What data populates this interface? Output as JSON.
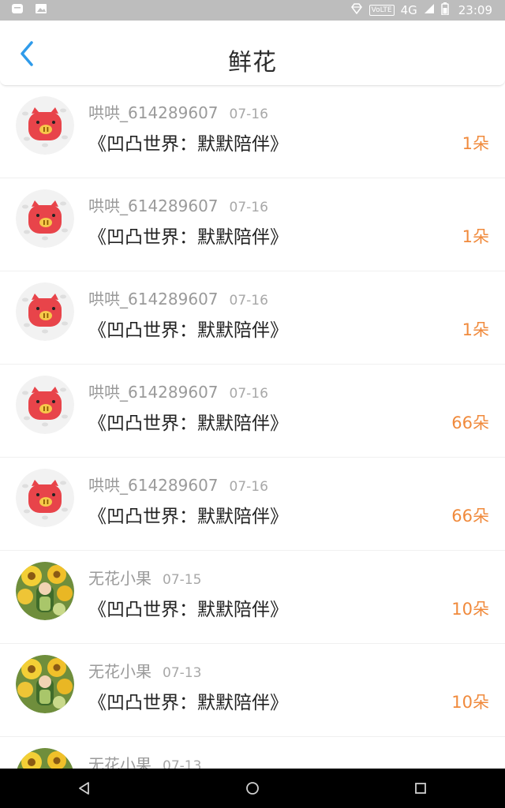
{
  "status_bar": {
    "volte": "VoLTE",
    "network": "4G",
    "time": "23:09"
  },
  "header": {
    "title": "鲜花"
  },
  "gifts": [
    {
      "user": "哄哄_614289607",
      "date": "07-16",
      "work": "《凹凸世界：默默陪伴》",
      "count": "1朵",
      "avatar": "pig"
    },
    {
      "user": "哄哄_614289607",
      "date": "07-16",
      "work": "《凹凸世界：默默陪伴》",
      "count": "1朵",
      "avatar": "pig"
    },
    {
      "user": "哄哄_614289607",
      "date": "07-16",
      "work": "《凹凸世界：默默陪伴》",
      "count": "1朵",
      "avatar": "pig"
    },
    {
      "user": "哄哄_614289607",
      "date": "07-16",
      "work": "《凹凸世界：默默陪伴》",
      "count": "66朵",
      "avatar": "pig"
    },
    {
      "user": "哄哄_614289607",
      "date": "07-16",
      "work": "《凹凸世界：默默陪伴》",
      "count": "66朵",
      "avatar": "pig"
    },
    {
      "user": "无花小果",
      "date": "07-15",
      "work": "《凹凸世界：默默陪伴》",
      "count": "10朵",
      "avatar": "flower"
    },
    {
      "user": "无花小果",
      "date": "07-13",
      "work": "《凹凸世界：默默陪伴》",
      "count": "10朵",
      "avatar": "flower"
    },
    {
      "user": "无花小果",
      "date": "07-13",
      "work": "",
      "count": "",
      "avatar": "flower"
    }
  ],
  "colors": {
    "accent": "#2f9bea",
    "count": "#f08a3c",
    "pig": "#e8444a"
  }
}
